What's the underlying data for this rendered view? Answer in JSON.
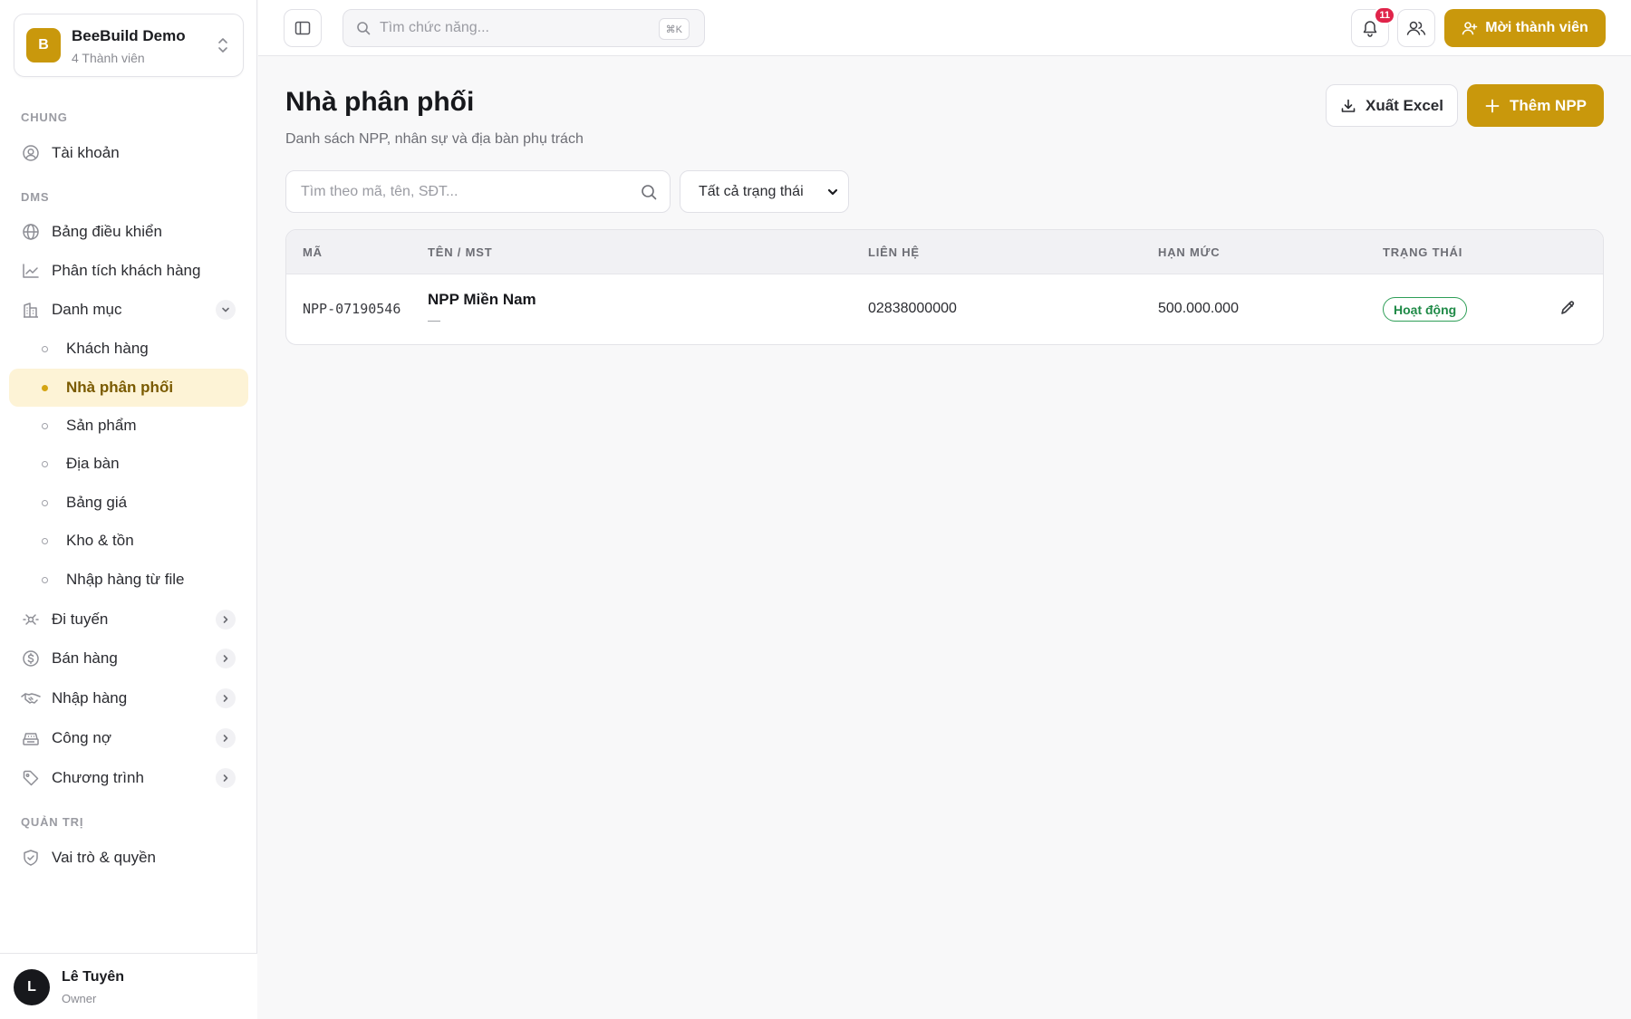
{
  "org": {
    "logo_letter": "B",
    "name": "BeeBuild Demo",
    "members": "4 Thành viên"
  },
  "sidebar": {
    "sections": {
      "chung": "CHUNG",
      "dms": "DMS",
      "quan_tri": "QUẢN TRỊ"
    },
    "account": "Tài khoản",
    "dashboard": "Bảng điều khiển",
    "customer_analysis": "Phân tích khách hàng",
    "catalog": "Danh mục",
    "catalog_items": [
      "Khách hàng",
      "Nhà phân phối",
      "Sản phẩm",
      "Địa bàn",
      "Bảng giá",
      "Kho & tồn",
      "Nhập hàng từ file"
    ],
    "routing": "Đi tuyến",
    "sales": "Bán hàng",
    "purchasing": "Nhập hàng",
    "debt": "Công nợ",
    "programs": "Chương trình",
    "roles": "Vai trò & quyền"
  },
  "user": {
    "initial": "L",
    "name": "Lê Tuyên",
    "role": "Owner"
  },
  "topbar": {
    "search_placeholder": "Tìm chức năng...",
    "shortcut": "⌘K",
    "notification_count": "11",
    "invite_label": "Mời thành viên"
  },
  "page": {
    "title": "Nhà phân phối",
    "subtitle": "Danh sách NPP, nhân sự và địa bàn phụ trách",
    "export_label": "Xuất Excel",
    "add_label": "Thêm NPP",
    "filter_placeholder": "Tìm theo mã, tên, SĐT...",
    "status_filter": "Tất cả trạng thái"
  },
  "table": {
    "headers": [
      "MÃ",
      "TÊN / MST",
      "LIÊN HỆ",
      "HẠN MỨC",
      "TRẠNG THÁI"
    ],
    "rows": [
      {
        "code": "NPP-07190546",
        "name": "NPP Miền Nam",
        "mst": "—",
        "phone": "02838000000",
        "limit": "500.000.000",
        "status": "Hoạt động"
      }
    ]
  },
  "colors": {
    "accent": "#c9980c",
    "active_bg": "#fdf3d6",
    "status_green": "#1f8a47",
    "badge_red": "#e0244a"
  }
}
